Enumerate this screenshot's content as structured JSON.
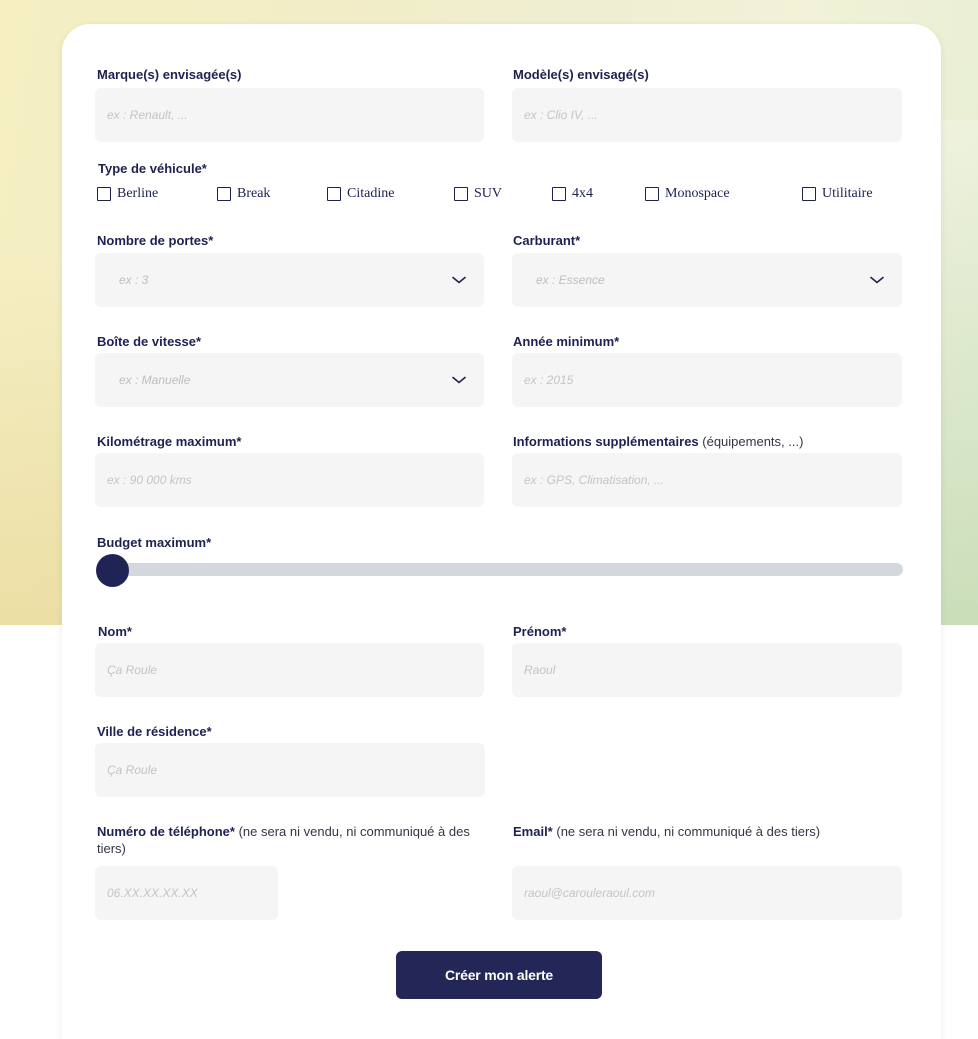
{
  "form": {
    "marques": {
      "label": "Marque(s) envisagée(s)",
      "placeholder": "ex : Renault, ..."
    },
    "modeles": {
      "label": "Modèle(s) envisagé(s)",
      "placeholder": "ex : Clio IV, ..."
    },
    "type_vehicule": {
      "label": "Type de véhicule*",
      "options": [
        "Berline",
        "Break",
        "Citadine",
        "SUV",
        "4x4",
        "Monospace",
        "Utilitaire"
      ]
    },
    "portes": {
      "label": "Nombre de portes*",
      "placeholder": "ex : 3"
    },
    "carburant": {
      "label": "Carburant*",
      "placeholder": "ex : Essence"
    },
    "boite": {
      "label": "Boîte de vitesse*",
      "placeholder": "ex : Manuelle"
    },
    "annee": {
      "label": "Année minimum*",
      "placeholder": "ex : 2015"
    },
    "kilometrage": {
      "label": "Kilométrage maximum*",
      "placeholder": "ex : 90 000 kms"
    },
    "infos": {
      "label": "Informations supplémentaires",
      "note": " (équipements, ...)",
      "placeholder": "ex : GPS, Climatisation, ..."
    },
    "budget": {
      "label": "Budget maximum*",
      "value": 0
    },
    "nom": {
      "label": "Nom*",
      "placeholder": "Ça Roule"
    },
    "prenom": {
      "label": "Prénom*",
      "placeholder": "Raoul"
    },
    "ville": {
      "label": "Ville de résidence*",
      "placeholder": "Ça Roule"
    },
    "telephone": {
      "label": "Numéro de téléphone*",
      "note": " (ne sera ni vendu, ni communiqué à des tiers)",
      "placeholder": "06.XX.XX.XX.XX"
    },
    "email": {
      "label": "Email*",
      "note": " (ne sera ni vendu, ni communiqué à des tiers)",
      "placeholder": "raoul@carouleraoul.com"
    },
    "submit_label": "Créer mon alerte"
  },
  "colors": {
    "primary": "#232656",
    "field_bg": "#f5f5f6",
    "track": "#d5d7df"
  }
}
